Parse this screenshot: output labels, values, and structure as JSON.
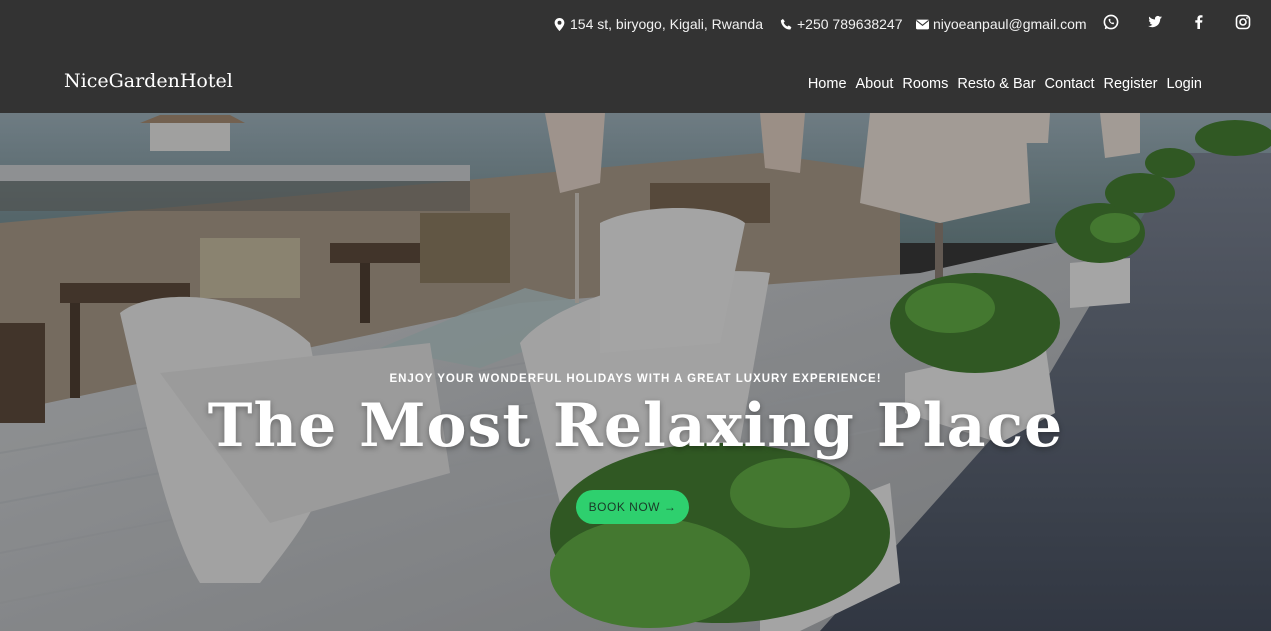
{
  "topbar": {
    "address": "154 st, biryogo, Kigali, Rwanda",
    "phone": "+250 789638247",
    "email": "niyoeanpaul@gmail.com",
    "social_icons": [
      "whatsapp-icon",
      "twitter-icon",
      "facebook-icon",
      "instagram-icon"
    ]
  },
  "nav": {
    "brand": "NiceGardenHotel",
    "items": [
      {
        "label": "Home"
      },
      {
        "label": "About"
      },
      {
        "label": "Rooms"
      },
      {
        "label": "Resto & Bar"
      },
      {
        "label": "Contact"
      },
      {
        "label": "Register"
      },
      {
        "label": "Login"
      }
    ]
  },
  "hero": {
    "tagline": "ENJOY YOUR WONDERFUL HOLIDAYS WITH A GREAT LUXURY EXPERIENCE!",
    "headline": "The Most Relaxing Place",
    "cta_label": "BOOK NOW →"
  },
  "colors": {
    "bar_bg": "#333333",
    "cta_bg": "#2ed06e",
    "text": "#ffffff"
  }
}
